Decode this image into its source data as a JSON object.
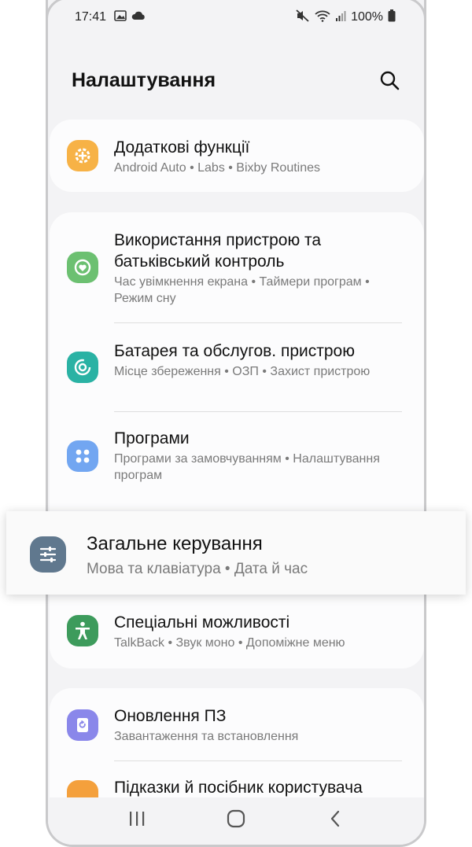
{
  "status_bar": {
    "time": "17:41",
    "battery": "100%"
  },
  "header": {
    "title": "Налаштування"
  },
  "items": [
    {
      "title": "Додаткові функції",
      "subtitle": "Android Auto  •  Labs  •  Bixby Routines",
      "icon": "plus-gear-icon",
      "color": "#f7b246"
    },
    {
      "title": "Використання пристрою та батьківський контроль",
      "subtitle": "Час увімкнення екрана  •  Таймери програм  •  Режим сну",
      "icon": "heart-cycle-icon",
      "color": "#6cc071"
    },
    {
      "title": "Батарея та обслугов. пристрою",
      "subtitle": "Місце збереження  •  ОЗП  •  Захист пристрою",
      "icon": "device-care-icon",
      "color": "#2ab2a4"
    },
    {
      "title": "Програми",
      "subtitle": "Програми за замовчуванням  •  Налаштування програм",
      "icon": "apps-grid-icon",
      "color": "#72a6f1"
    },
    {
      "title": "Загальне керування",
      "subtitle": "Мова та клавіатура  •  Дата й час",
      "icon": "sliders-icon",
      "color": "#60788e"
    },
    {
      "title": "Спеціальні можливості",
      "subtitle": "TalkBack  •  Звук моно  •  Допоміжне меню",
      "icon": "accessibility-person-icon",
      "color": "#3d9b5c"
    },
    {
      "title": "Оновлення ПЗ",
      "subtitle": "Завантаження та встановлення",
      "icon": "software-update-icon",
      "color": "#8a87ea"
    },
    {
      "title": "Підказки й посібник користувача",
      "subtitle": "",
      "icon": "tips-icon",
      "color": "#f4a03c"
    }
  ],
  "navbar": {
    "recents_icon": "recents-icon",
    "home_icon": "home-icon",
    "back_icon": "back-icon"
  }
}
